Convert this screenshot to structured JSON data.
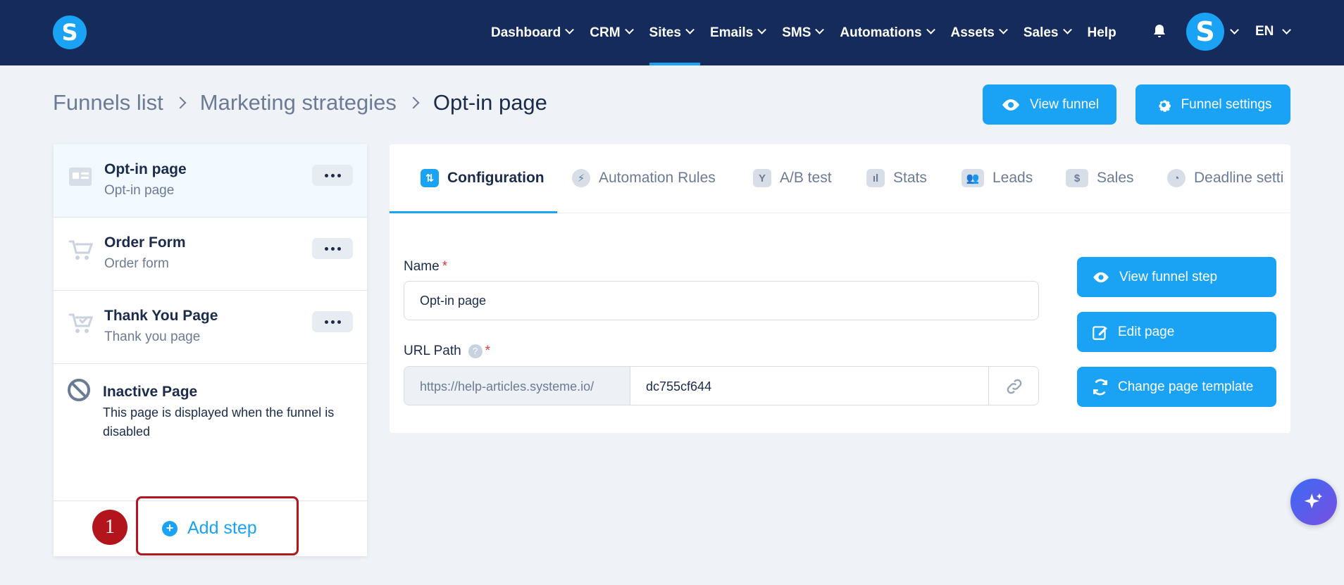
{
  "nav": {
    "logo": "S",
    "items": [
      {
        "label": "Dashboard",
        "active": false
      },
      {
        "label": "CRM",
        "active": false
      },
      {
        "label": "Sites",
        "active": true
      },
      {
        "label": "Emails",
        "active": false
      },
      {
        "label": "SMS",
        "active": false
      },
      {
        "label": "Automations",
        "active": false
      },
      {
        "label": "Assets",
        "active": false
      },
      {
        "label": "Sales",
        "active": false
      }
    ],
    "help": "Help",
    "avatar": "S",
    "lang": "EN"
  },
  "breadcrumb": {
    "items": [
      "Funnels list",
      "Marketing strategies"
    ],
    "current": "Opt-in page"
  },
  "header_buttons": {
    "view_funnel": "View funnel",
    "funnel_settings": "Funnel settings"
  },
  "steps": [
    {
      "title": "Opt-in page",
      "subtitle": "Opt-in page",
      "icon": "page-layout-icon",
      "active": true
    },
    {
      "title": "Order Form",
      "subtitle": "Order form",
      "icon": "cart-icon",
      "active": false
    },
    {
      "title": "Thank You Page",
      "subtitle": "Thank you page",
      "icon": "cart-check-icon",
      "active": false
    }
  ],
  "inactive_page": {
    "title": "Inactive Page",
    "description": "This page is displayed when the funnel is disabled"
  },
  "add_step": {
    "label": "Add step",
    "annotation_number": "1"
  },
  "tabs": [
    {
      "label": "Configuration",
      "active": true,
      "icon": "sliders-icon"
    },
    {
      "label": "Automation Rules",
      "active": false,
      "icon": "bolt-icon"
    },
    {
      "label": "A/B test",
      "active": false,
      "icon": "split-icon"
    },
    {
      "label": "Stats",
      "active": false,
      "icon": "bar-chart-icon"
    },
    {
      "label": "Leads",
      "active": false,
      "icon": "users-icon"
    },
    {
      "label": "Sales",
      "active": false,
      "icon": "dollar-icon"
    },
    {
      "label": "Deadline setti",
      "active": false,
      "icon": "clock-icon"
    }
  ],
  "form": {
    "name_label": "Name",
    "name_value": "Opt-in page",
    "url_label": "URL Path",
    "url_prefix": "https://help-articles.systeme.io/",
    "url_slug": "dc755cf644",
    "required_mark": "*",
    "help_mark": "?"
  },
  "side_buttons": {
    "view_step": "View funnel step",
    "edit_page": "Edit page",
    "change_template": "Change page template"
  },
  "colors": {
    "nav_bg": "#142b5c",
    "accent": "#1aa3f5",
    "annotation": "#b3151c"
  }
}
